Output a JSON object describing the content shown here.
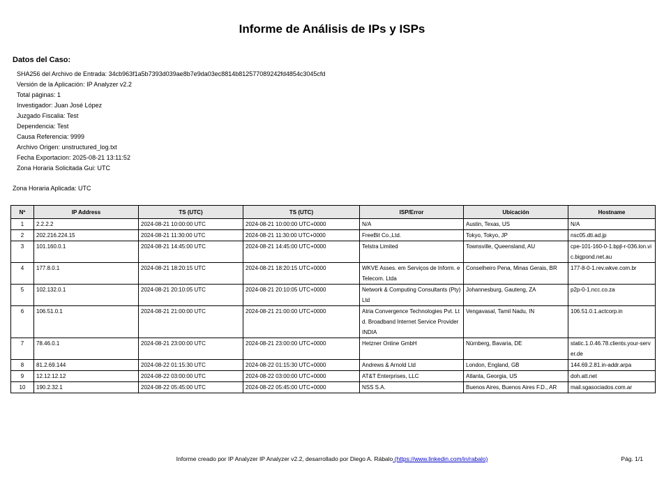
{
  "title": "Informe de Análisis de IPs y ISPs",
  "case": {
    "heading": "Datos del Caso:",
    "lines": [
      "SHA256 del Archivo de Entrada: 34cb963f1a5b7393d039ae8b7e9da03ec8814b812577089242fd4854c3045cfd",
      "Versión de la Aplicación: IP Analyzer v2.2",
      "Total páginas: 1",
      "Investigador: Juan José López",
      "Juzgado Fiscalia: Test",
      "Dependencia: Test",
      "Causa Referencia: 9999",
      "Archivo Origen: unstructured_log.txt",
      "Fecha Exportacion: 2025-08-21 13:11:52",
      "Zona Horaria Solicitada Gui: UTC"
    ],
    "applied_tz": "Zona Horaria Aplicada: UTC"
  },
  "table": {
    "headers": [
      "Nº",
      "IP Address",
      "TS (UTC)",
      "TS (UTC)",
      "ISP/Error",
      "Ubicación",
      "Hostname"
    ],
    "rows": [
      [
        "1",
        "2.2.2.2",
        "2024-08-21 10:00:00 UTC",
        "2024-08-21 10:00:00 UTC+0000",
        "N/A",
        "Austin, Texas, US",
        "N/A"
      ],
      [
        "2",
        "202.216.224.15",
        "2024-08-21 11:30:00 UTC",
        "2024-08-21 11:30:00 UTC+0000",
        "FreeBit Co.,Ltd.",
        "Tokyo, Tokyo, JP",
        "nsc05.dti.ad.jp"
      ],
      [
        "3",
        "101.160.0.1",
        "2024-08-21 14:45:00 UTC",
        "2024-08-21 14:45:00 UTC+0000",
        "Telstra Limited",
        "Townsville, Queensland, AU",
        "cpe-101-160-0-1.bpjl-r-036.lon.vic.bigpond.net.au"
      ],
      [
        "4",
        "177.8.0.1",
        "2024-08-21 18:20:15 UTC",
        "2024-08-21 18:20:15 UTC+0000",
        "WKVE Asses. em Serviços de Inform. e Telecom. Ltda",
        "Conselheiro Pena, Minas Gerais, BR",
        "177-8-0-1.rev.wkve.com.br"
      ],
      [
        "5",
        "102.132.0.1",
        "2024-08-21 20:10:05 UTC",
        "2024-08-21 20:10:05 UTC+0000",
        "Network & Computing Consultants (Pty) Ltd",
        "Johannesburg, Gauteng, ZA",
        "p2p-0-1.ncc.co.za"
      ],
      [
        "6",
        "106.51.0.1",
        "2024-08-21 21:00:00 UTC",
        "2024-08-21 21:00:00 UTC+0000",
        "Atria Convergence Technologies Pvt. Ltd. Broadband Internet Service Provider INDIA",
        "Vengavasal, Tamil Nadu, IN",
        "106.51.0.1.actcorp.in"
      ],
      [
        "7",
        "78.46.0.1",
        "2024-08-21 23:00:00 UTC",
        "2024-08-21 23:00:00 UTC+0000",
        "Hetzner Online GmbH",
        "Nürnberg, Bavaria, DE",
        "static.1.0.46.78.clients.your-server.de"
      ],
      [
        "8",
        "81.2.69.144",
        "2024-08-22 01:15:30 UTC",
        "2024-08-22 01:15:30 UTC+0000",
        "Andrews & Arnold Ltd",
        "London, England, GB",
        "144.69.2.81.in-addr.arpa"
      ],
      [
        "9",
        "12.12.12.12",
        "2024-08-22 03:00:00 UTC",
        "2024-08-22 03:00:00 UTC+0000",
        "AT&T Enterprises, LLC",
        "Atlanta, Georgia, US",
        "doh.att.net"
      ],
      [
        "10",
        "190.2.32.1",
        "2024-08-22 05:45:00 UTC",
        "2024-08-22 05:45:00 UTC+0000",
        "NSS S.A.",
        "Buenos Aires, Buenos Aires F.D., AR",
        "mail.sgasociados.com.ar"
      ]
    ]
  },
  "footer": {
    "text": "Informe creado por IP Analyzer IP Analyzer v2.2, desarrollado por Diego A. Rábalo",
    "link": " (https://www.linkedin.com/in/rabalo)",
    "page": "Pág. 1/1"
  }
}
